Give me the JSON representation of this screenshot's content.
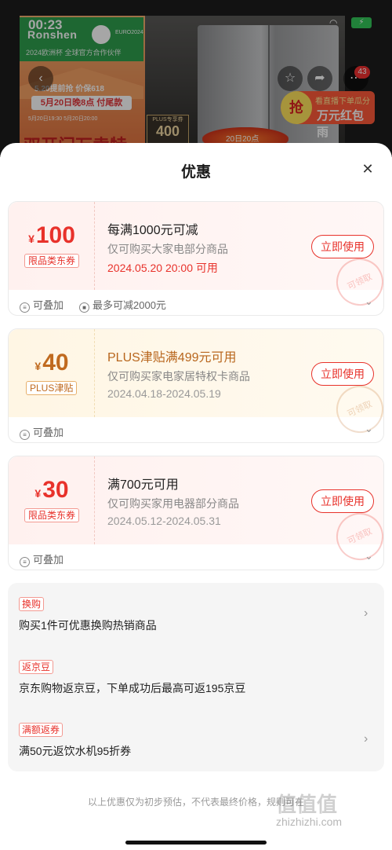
{
  "status_bar": {
    "time": "00:23",
    "battery": "⚡"
  },
  "banner": {
    "brand": "Ronshen",
    "brand_sub": "2024欧洲杯 全球官方合作伙伴",
    "euro": "EURO2024",
    "promo_line1": "5.20提前抢 价保618",
    "promo_date": "5月20日晚8点 付尾款",
    "promo_times": "5月20日19:30  5月20日20:00",
    "promo_big": "双开门万卖特",
    "plus_card": {
      "label": "PLUS专享券",
      "value": "400"
    },
    "red_bag": {
      "icon": "抢",
      "line1": "看直播下单瓜分",
      "line2": "万元红包雨"
    },
    "flame": "20日20点",
    "notification_count": "43"
  },
  "sheet": {
    "title": "优惠",
    "coupons": [
      {
        "currency": "¥",
        "amount": "100",
        "tag": "限品类东券",
        "title": "每满1000元可减",
        "desc": "仅可购买大家电部分商品",
        "date": "2024.05.20 20:00 可用",
        "button": "立即使用",
        "stamp": "可领取",
        "foot_stack": "可叠加",
        "foot_limit": "最多可减2000元"
      },
      {
        "currency": "¥",
        "amount": "40",
        "tag": "PLUS津贴",
        "title": "PLUS津贴满499元可用",
        "desc": "仅可购买家电家居特权卡商品",
        "date": "2024.04.18-2024.05.19",
        "button": "立即使用",
        "stamp": "可领取",
        "foot_stack": "可叠加"
      },
      {
        "currency": "¥",
        "amount": "30",
        "tag": "限品类东券",
        "title": "满700元可用",
        "desc": "仅可购买家用电器部分商品",
        "date": "2024.05.12-2024.05.31",
        "button": "立即使用",
        "stamp": "可领取",
        "foot_stack": "可叠加"
      }
    ],
    "benefits": [
      {
        "tag": "换购",
        "text": "购买1件可优惠换购热销商品"
      },
      {
        "tag": "返京豆",
        "text": "京东购物返京豆，下单成功后最高可返195京豆"
      },
      {
        "tag": "满额返券",
        "text": "满50元返饮水机95折券"
      }
    ],
    "disclaimer": "以上优惠仅为初步预估，不代表最终价格，规则可在",
    "watermark": "值值值",
    "watermark_url": "zhizhizhi.com"
  },
  "colors": {
    "accent_red": "#e8322b",
    "gold": "#c06a1f",
    "sheet_bg": "#ffffff"
  }
}
